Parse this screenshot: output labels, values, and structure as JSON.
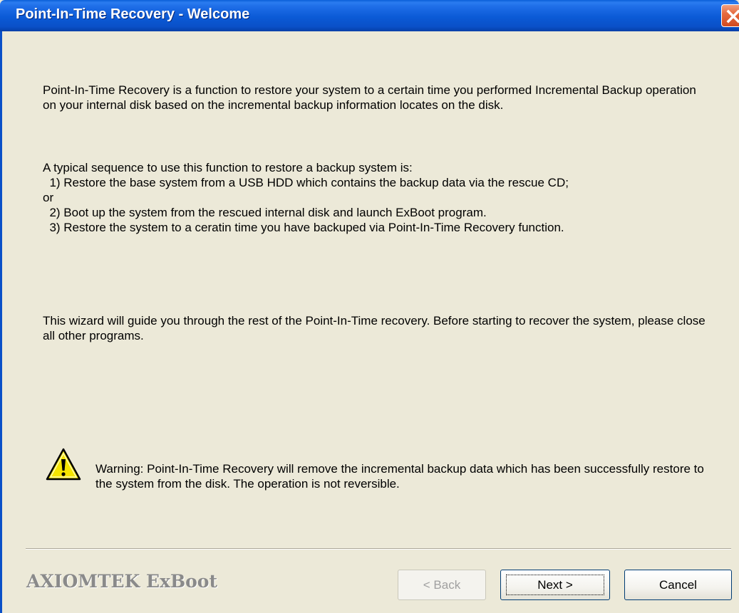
{
  "window": {
    "title": "Point-In-Time Recovery - Welcome"
  },
  "intro": {
    "text": "Point-In-Time Recovery is a function to restore your system to a certain time you performed Incremental Backup operation on your internal disk based on the incremental backup information locates on the disk."
  },
  "sequence": {
    "heading": "A typical sequence to use this function to restore a backup system is:",
    "steps": [
      "  1) Restore the base system from a USB HDD which contains the backup data via the rescue CD;",
      "or",
      "  2) Boot up the system from the rescued internal disk and launch ExBoot program.",
      "  3) Restore the system to a ceratin time you have backuped via Point-In-Time Recovery function."
    ]
  },
  "guide": {
    "text": "This wizard will guide you through the rest of the Point-In-Time recovery.  Before starting to recover the system, please close all other programs."
  },
  "warning": {
    "icon": "warning-icon",
    "text": "Warning: Point-In-Time Recovery will remove the incremental backup data which has been successfully restore to the system from the disk. The operation is not reversible."
  },
  "footer": {
    "brand": "AXIOMTEK ExBoot",
    "back_label": "< Back",
    "next_label": "Next >",
    "cancel_label": "Cancel"
  },
  "colors": {
    "titlebar": "#0a50c8",
    "dialog_bg": "#ece9d8",
    "close_button": "#d14a20"
  }
}
